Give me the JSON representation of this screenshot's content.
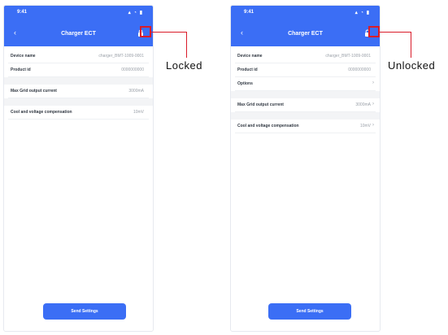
{
  "screens": [
    {
      "status_time": "9:41",
      "status_icons": "▴ ◔ ▮",
      "title": "Charger ECT",
      "lock_state": "locked",
      "rows": [
        {
          "label": "Device name",
          "value": "charger_BMT-1009-0001",
          "chevron": ""
        },
        {
          "label": "Product id",
          "value": "0000000000",
          "chevron": ""
        },
        {
          "label": "Max Grid output current",
          "value": "3000mA",
          "chevron": ""
        },
        {
          "label": "Cool and voltage compensation",
          "value": "10mV",
          "chevron": ""
        }
      ],
      "button_label": "Send Settings",
      "callout_label": "Locked"
    },
    {
      "status_time": "9:41",
      "status_icons": "▴ ◔ ▮",
      "title": "Charger ECT",
      "lock_state": "unlocked",
      "rows": [
        {
          "label": "Device name",
          "value": "charger_BMT-1009-0001",
          "chevron": ""
        },
        {
          "label": "Product id",
          "value": "0000000000",
          "chevron": ""
        },
        {
          "label": "Options",
          "value": "",
          "chevron": "›"
        },
        {
          "label": "Max Grid output current",
          "value": "3000mA",
          "chevron": "›"
        },
        {
          "label": "Cool and voltage compensation",
          "value": "10mV",
          "chevron": "›"
        }
      ],
      "button_label": "Send Settings",
      "callout_label": "Unlocked"
    }
  ],
  "colors": {
    "accent": "#3b6ef5",
    "callout": "#d91c2a"
  },
  "icons": {
    "back": "chevron-left-icon",
    "locked": "lock-closed-icon",
    "unlocked": "lock-open-icon"
  }
}
